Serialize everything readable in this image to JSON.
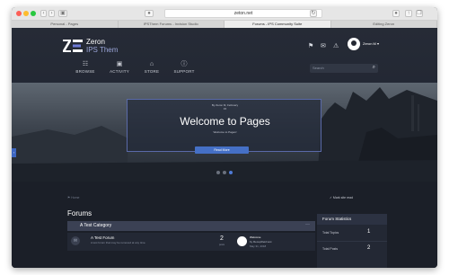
{
  "browser": {
    "url": "zeton.net",
    "tabs": [
      {
        "label": "Personal - Pages",
        "active": false
      },
      {
        "label": "IPSThem Forums - Invision Studio",
        "active": false
      },
      {
        "label": "Forums - IPS Community Suite",
        "active": true
      },
      {
        "label": "Editing Zeron",
        "active": false
      }
    ]
  },
  "site": {
    "logo_text": "Zeron",
    "logo_sub": "IPS Them",
    "user_name": "Zeron M ▾",
    "nav": [
      {
        "icon": "☷",
        "label": "BROWSE"
      },
      {
        "icon": "▣",
        "label": "ACTIVITY"
      },
      {
        "icon": "⌂",
        "label": "STORE"
      },
      {
        "icon": "ⓘ",
        "label": "SUPPORT"
      }
    ],
    "search_placeholder": "Search",
    "icons": {
      "bell": "⚑",
      "mail": "✉",
      "alert": "⚠",
      "search": "⌕",
      "arrow": "‹"
    }
  },
  "hero": {
    "meta_by": "By Zeron M, February",
    "meta_count": "15",
    "title": "Welcome to Pages",
    "subtitle": "Welcome to Pages!",
    "read_more": "Read More",
    "slides": 3,
    "active_slide": 3
  },
  "content": {
    "breadcrumb": "⚑ Home",
    "mark_read": "✓ Mark site read",
    "forums_title": "Forums",
    "category": {
      "title": "A Test Category",
      "toggle": "—"
    },
    "forum": {
      "name": "A Test Forum",
      "description": "A test forum that may be removed at any time.",
      "count": "2",
      "count_label": "posts",
      "last_title": "Welcome",
      "last_by": "by RecepReid test",
      "last_date": "May 31, 2018"
    },
    "stats": {
      "title": "Forum Statistics",
      "rows": [
        {
          "label": "Total Topics",
          "value": "1"
        },
        {
          "label": "Total Posts",
          "value": "2"
        }
      ]
    }
  },
  "colors": {
    "accent": "#4570c6",
    "header": "#262b36",
    "panel": "#232834"
  }
}
